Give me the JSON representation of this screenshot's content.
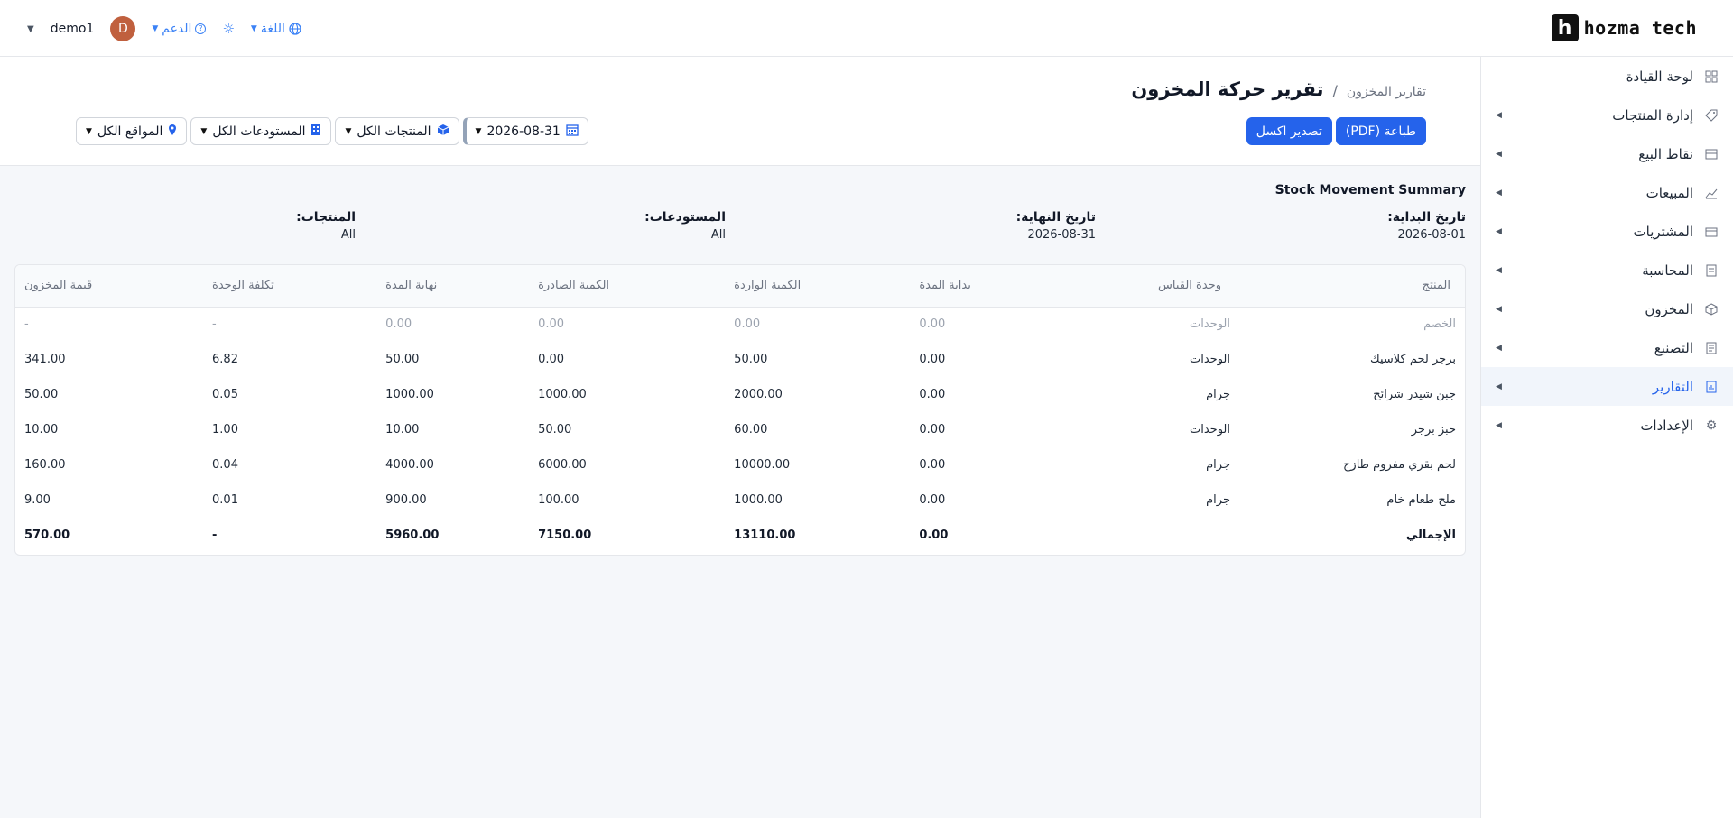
{
  "brand": {
    "name": "hozma tech",
    "mark": "h"
  },
  "topbar": {
    "user_name": "demo1",
    "avatar_letter": "D",
    "support_label": "الدعم",
    "language_label": "اللغة"
  },
  "sidebar": {
    "items": [
      {
        "label": "لوحة القيادة",
        "icon": "dashboard-icon",
        "has_arrow": false
      },
      {
        "label": "إدارة المنتجات",
        "icon": "tag-icon",
        "has_arrow": true
      },
      {
        "label": "نقاط البيع",
        "icon": "store-icon",
        "has_arrow": true
      },
      {
        "label": "المبيعات",
        "icon": "chart-line-icon",
        "has_arrow": true
      },
      {
        "label": "المشتريات",
        "icon": "wallet-icon",
        "has_arrow": true
      },
      {
        "label": "المحاسبة",
        "icon": "ledger-icon",
        "has_arrow": true
      },
      {
        "label": "المخزون",
        "icon": "box-icon",
        "has_arrow": true
      },
      {
        "label": "التصنيع",
        "icon": "document-icon",
        "has_arrow": true
      },
      {
        "label": "التقارير",
        "icon": "report-icon",
        "has_arrow": true,
        "active": true
      },
      {
        "label": "الإعدادات",
        "icon": "gear-icon",
        "has_arrow": true
      }
    ]
  },
  "header": {
    "breadcrumb_parent": "تقارير المخزون",
    "breadcrumb_sep": "/",
    "title": "تقرير حركة المخزون",
    "print_pdf_label": "طباعة (PDF)",
    "export_excel_label": "تصدير اكسل"
  },
  "filters": {
    "date": "2026-08-31",
    "products": "المنتجات الكل",
    "warehouses": "المستودعات الكل",
    "locations": "المواقع الكل"
  },
  "report": {
    "title": "Stock Movement Summary",
    "start_label": "تاريخ البداية:",
    "start_value": "2026-08-01",
    "end_label": "تاريخ النهاية:",
    "end_value": "2026-08-31",
    "warehouses_label": "المستودعات:",
    "warehouses_value": "All",
    "products_label": "المنتجات:",
    "products_value": "All"
  },
  "table": {
    "headers": [
      "المنتج",
      "وحدة القياس",
      "بداية المدة",
      "الكمية الواردة",
      "الكمية الصادرة",
      "نهاية المدة",
      "تكلفة الوحدة",
      "قيمة المخزون"
    ],
    "rows": [
      [
        "الخصم",
        "الوحدات",
        "0.00",
        "0.00",
        "0.00",
        "0.00",
        "-",
        "-"
      ],
      [
        "برجر لحم كلاسيك",
        "الوحدات",
        "0.00",
        "50.00",
        "0.00",
        "50.00",
        "6.82",
        "341.00"
      ],
      [
        "جبن شيدر شرائح",
        "جرام",
        "0.00",
        "2000.00",
        "1000.00",
        "1000.00",
        "0.05",
        "50.00"
      ],
      [
        "خبز برجر",
        "الوحدات",
        "0.00",
        "60.00",
        "50.00",
        "10.00",
        "1.00",
        "10.00"
      ],
      [
        "لحم بقري مفروم طازج",
        "جرام",
        "0.00",
        "10000.00",
        "6000.00",
        "4000.00",
        "0.04",
        "160.00"
      ],
      [
        "ملح طعام خام",
        "جرام",
        "0.00",
        "1000.00",
        "100.00",
        "900.00",
        "0.01",
        "9.00"
      ]
    ],
    "total": [
      "الإجمالي",
      "",
      "0.00",
      "13110.00",
      "7150.00",
      "5960.00",
      "-",
      "570.00"
    ]
  }
}
